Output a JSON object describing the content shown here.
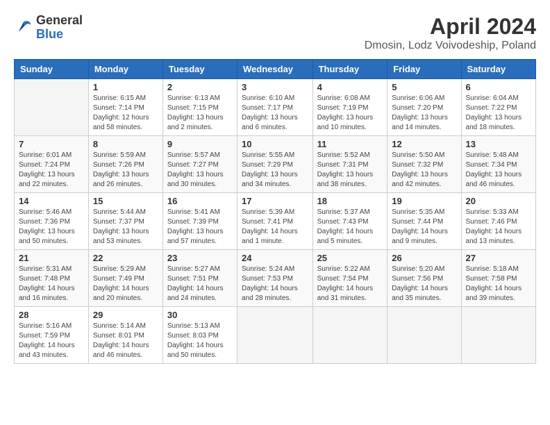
{
  "header": {
    "logo_general": "General",
    "logo_blue": "Blue",
    "month_year": "April 2024",
    "location": "Dmosin, Lodz Voivodeship, Poland"
  },
  "weekdays": [
    "Sunday",
    "Monday",
    "Tuesday",
    "Wednesday",
    "Thursday",
    "Friday",
    "Saturday"
  ],
  "weeks": [
    [
      {
        "day": "",
        "sunrise": "",
        "sunset": "",
        "daylight": ""
      },
      {
        "day": "1",
        "sunrise": "Sunrise: 6:15 AM",
        "sunset": "Sunset: 7:14 PM",
        "daylight": "Daylight: 12 hours and 58 minutes."
      },
      {
        "day": "2",
        "sunrise": "Sunrise: 6:13 AM",
        "sunset": "Sunset: 7:15 PM",
        "daylight": "Daylight: 13 hours and 2 minutes."
      },
      {
        "day": "3",
        "sunrise": "Sunrise: 6:10 AM",
        "sunset": "Sunset: 7:17 PM",
        "daylight": "Daylight: 13 hours and 6 minutes."
      },
      {
        "day": "4",
        "sunrise": "Sunrise: 6:08 AM",
        "sunset": "Sunset: 7:19 PM",
        "daylight": "Daylight: 13 hours and 10 minutes."
      },
      {
        "day": "5",
        "sunrise": "Sunrise: 6:06 AM",
        "sunset": "Sunset: 7:20 PM",
        "daylight": "Daylight: 13 hours and 14 minutes."
      },
      {
        "day": "6",
        "sunrise": "Sunrise: 6:04 AM",
        "sunset": "Sunset: 7:22 PM",
        "daylight": "Daylight: 13 hours and 18 minutes."
      }
    ],
    [
      {
        "day": "7",
        "sunrise": "Sunrise: 6:01 AM",
        "sunset": "Sunset: 7:24 PM",
        "daylight": "Daylight: 13 hours and 22 minutes."
      },
      {
        "day": "8",
        "sunrise": "Sunrise: 5:59 AM",
        "sunset": "Sunset: 7:26 PM",
        "daylight": "Daylight: 13 hours and 26 minutes."
      },
      {
        "day": "9",
        "sunrise": "Sunrise: 5:57 AM",
        "sunset": "Sunset: 7:27 PM",
        "daylight": "Daylight: 13 hours and 30 minutes."
      },
      {
        "day": "10",
        "sunrise": "Sunrise: 5:55 AM",
        "sunset": "Sunset: 7:29 PM",
        "daylight": "Daylight: 13 hours and 34 minutes."
      },
      {
        "day": "11",
        "sunrise": "Sunrise: 5:52 AM",
        "sunset": "Sunset: 7:31 PM",
        "daylight": "Daylight: 13 hours and 38 minutes."
      },
      {
        "day": "12",
        "sunrise": "Sunrise: 5:50 AM",
        "sunset": "Sunset: 7:32 PM",
        "daylight": "Daylight: 13 hours and 42 minutes."
      },
      {
        "day": "13",
        "sunrise": "Sunrise: 5:48 AM",
        "sunset": "Sunset: 7:34 PM",
        "daylight": "Daylight: 13 hours and 46 minutes."
      }
    ],
    [
      {
        "day": "14",
        "sunrise": "Sunrise: 5:46 AM",
        "sunset": "Sunset: 7:36 PM",
        "daylight": "Daylight: 13 hours and 50 minutes."
      },
      {
        "day": "15",
        "sunrise": "Sunrise: 5:44 AM",
        "sunset": "Sunset: 7:37 PM",
        "daylight": "Daylight: 13 hours and 53 minutes."
      },
      {
        "day": "16",
        "sunrise": "Sunrise: 5:41 AM",
        "sunset": "Sunset: 7:39 PM",
        "daylight": "Daylight: 13 hours and 57 minutes."
      },
      {
        "day": "17",
        "sunrise": "Sunrise: 5:39 AM",
        "sunset": "Sunset: 7:41 PM",
        "daylight": "Daylight: 14 hours and 1 minute."
      },
      {
        "day": "18",
        "sunrise": "Sunrise: 5:37 AM",
        "sunset": "Sunset: 7:43 PM",
        "daylight": "Daylight: 14 hours and 5 minutes."
      },
      {
        "day": "19",
        "sunrise": "Sunrise: 5:35 AM",
        "sunset": "Sunset: 7:44 PM",
        "daylight": "Daylight: 14 hours and 9 minutes."
      },
      {
        "day": "20",
        "sunrise": "Sunrise: 5:33 AM",
        "sunset": "Sunset: 7:46 PM",
        "daylight": "Daylight: 14 hours and 13 minutes."
      }
    ],
    [
      {
        "day": "21",
        "sunrise": "Sunrise: 5:31 AM",
        "sunset": "Sunset: 7:48 PM",
        "daylight": "Daylight: 14 hours and 16 minutes."
      },
      {
        "day": "22",
        "sunrise": "Sunrise: 5:29 AM",
        "sunset": "Sunset: 7:49 PM",
        "daylight": "Daylight: 14 hours and 20 minutes."
      },
      {
        "day": "23",
        "sunrise": "Sunrise: 5:27 AM",
        "sunset": "Sunset: 7:51 PM",
        "daylight": "Daylight: 14 hours and 24 minutes."
      },
      {
        "day": "24",
        "sunrise": "Sunrise: 5:24 AM",
        "sunset": "Sunset: 7:53 PM",
        "daylight": "Daylight: 14 hours and 28 minutes."
      },
      {
        "day": "25",
        "sunrise": "Sunrise: 5:22 AM",
        "sunset": "Sunset: 7:54 PM",
        "daylight": "Daylight: 14 hours and 31 minutes."
      },
      {
        "day": "26",
        "sunrise": "Sunrise: 5:20 AM",
        "sunset": "Sunset: 7:56 PM",
        "daylight": "Daylight: 14 hours and 35 minutes."
      },
      {
        "day": "27",
        "sunrise": "Sunrise: 5:18 AM",
        "sunset": "Sunset: 7:58 PM",
        "daylight": "Daylight: 14 hours and 39 minutes."
      }
    ],
    [
      {
        "day": "28",
        "sunrise": "Sunrise: 5:16 AM",
        "sunset": "Sunset: 7:59 PM",
        "daylight": "Daylight: 14 hours and 43 minutes."
      },
      {
        "day": "29",
        "sunrise": "Sunrise: 5:14 AM",
        "sunset": "Sunset: 8:01 PM",
        "daylight": "Daylight: 14 hours and 46 minutes."
      },
      {
        "day": "30",
        "sunrise": "Sunrise: 5:13 AM",
        "sunset": "Sunset: 8:03 PM",
        "daylight": "Daylight: 14 hours and 50 minutes."
      },
      {
        "day": "",
        "sunrise": "",
        "sunset": "",
        "daylight": ""
      },
      {
        "day": "",
        "sunrise": "",
        "sunset": "",
        "daylight": ""
      },
      {
        "day": "",
        "sunrise": "",
        "sunset": "",
        "daylight": ""
      },
      {
        "day": "",
        "sunrise": "",
        "sunset": "",
        "daylight": ""
      }
    ]
  ]
}
